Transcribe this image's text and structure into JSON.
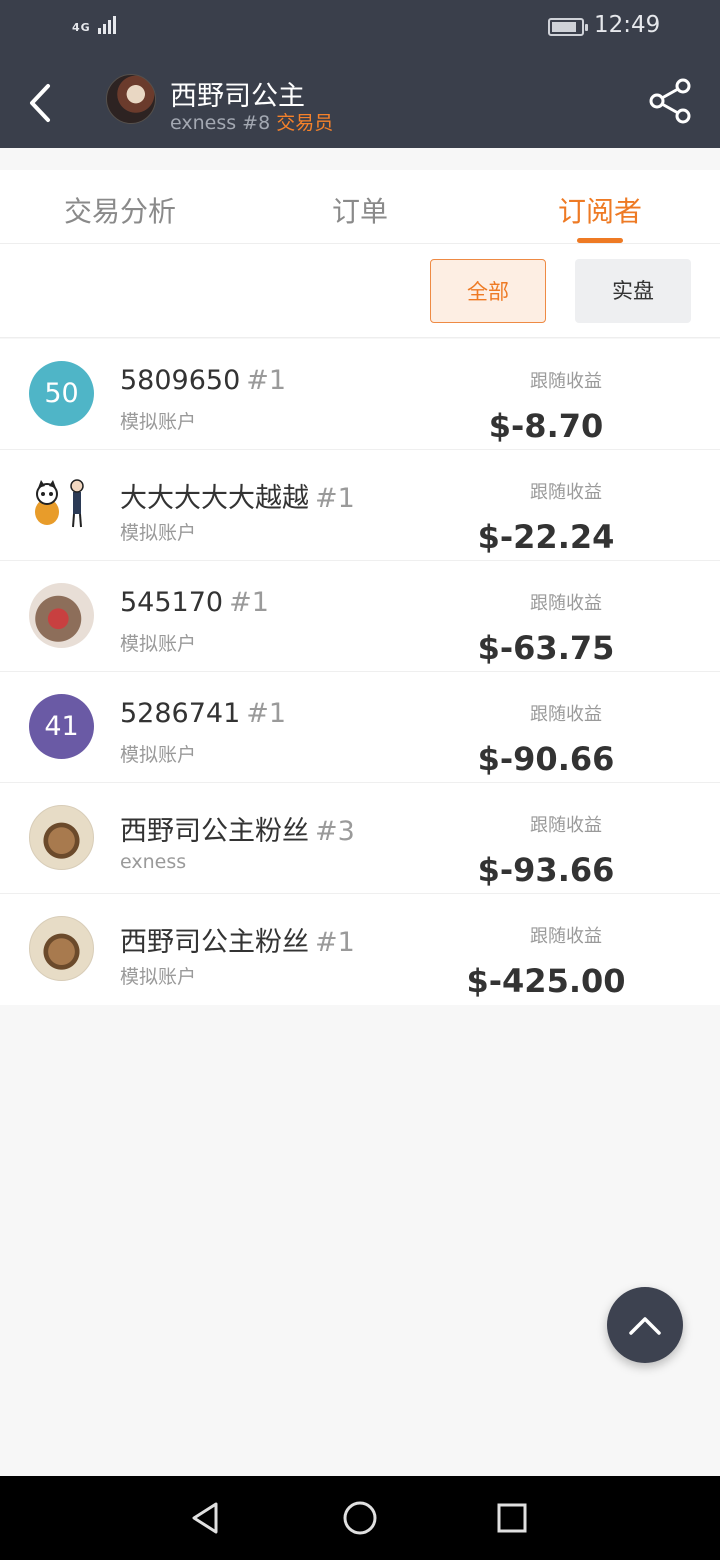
{
  "status_bar": {
    "network": "4G",
    "time": "12:49"
  },
  "header": {
    "title": "西野司公主",
    "subtitle_account": "exness #8",
    "subtitle_role": "交易员",
    "back_icon": "chevron-left-icon",
    "share_icon": "share-icon"
  },
  "tabs": [
    {
      "label": "交易分析",
      "active": false
    },
    {
      "label": "订单",
      "active": false
    },
    {
      "label": "订阅者",
      "active": true
    }
  ],
  "filters": {
    "all_label": "全部",
    "real_label": "实盘"
  },
  "subscribers": [
    {
      "avatar_text": "50",
      "name": "5809650",
      "rank": "#1",
      "account": "模拟账户",
      "pnl_label": "跟随收益",
      "pnl": "$-8.70"
    },
    {
      "avatar_text": "",
      "name": "大大大大大越越",
      "rank": "#1",
      "account": "模拟账户",
      "pnl_label": "跟随收益",
      "pnl": "$-22.24"
    },
    {
      "avatar_text": "",
      "name": "545170",
      "rank": "#1",
      "account": "模拟账户",
      "pnl_label": "跟随收益",
      "pnl": "$-63.75"
    },
    {
      "avatar_text": "41",
      "name": "5286741",
      "rank": "#1",
      "account": "模拟账户",
      "pnl_label": "跟随收益",
      "pnl": "$-90.66"
    },
    {
      "avatar_text": "",
      "name": "西野司公主粉丝",
      "rank": "#3",
      "account": "exness",
      "pnl_label": "跟随收益",
      "pnl": "$-93.66"
    },
    {
      "avatar_text": "",
      "name": "西野司公主粉丝",
      "rank": "#1",
      "account": "模拟账户",
      "pnl_label": "跟随收益",
      "pnl": "$-425.00"
    }
  ],
  "colors": {
    "header_bg": "#3a3f4b",
    "accent": "#ee7a24",
    "teal_avatar": "#4fb5c7",
    "purple_avatar": "#6a5aa5"
  },
  "fab_icon": "chevron-up-icon",
  "nav": {
    "back_icon": "triangle-back-icon",
    "home_icon": "circle-home-icon",
    "recent_icon": "square-recent-icon"
  }
}
